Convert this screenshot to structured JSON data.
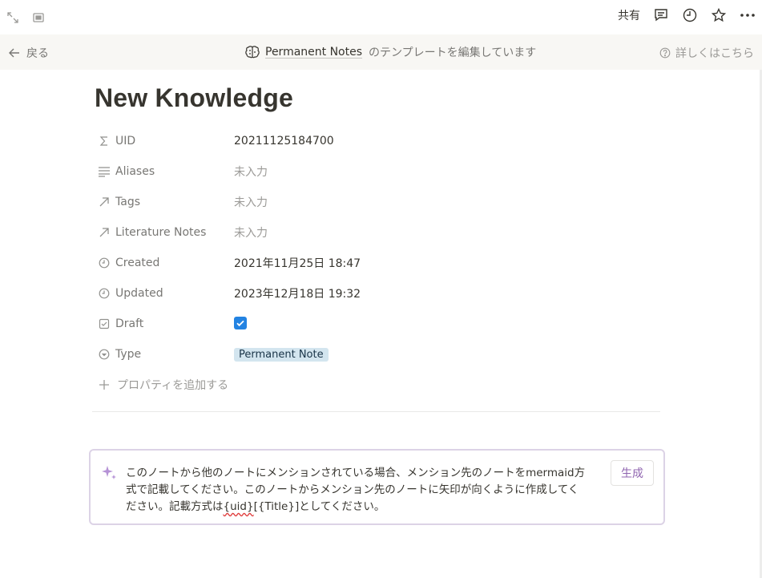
{
  "topbar": {
    "share_label": "共有"
  },
  "banner": {
    "back_label": "戻る",
    "database_name": "Permanent Notes",
    "message": "のテンプレートを編集しています",
    "help_label": "詳しくはこちら"
  },
  "page": {
    "title": "New Knowledge"
  },
  "properties": [
    {
      "name": "UID",
      "icon": "sigma-icon",
      "value": "20211125184700",
      "empty": false
    },
    {
      "name": "Aliases",
      "icon": "text-lines-icon",
      "value": "未入力",
      "empty": true
    },
    {
      "name": "Tags",
      "icon": "relation-arrow-icon",
      "value": "未入力",
      "empty": true
    },
    {
      "name": "Literature Notes",
      "icon": "relation-arrow-icon",
      "value": "未入力",
      "empty": true
    },
    {
      "name": "Created",
      "icon": "clock-icon",
      "value": "2021年11月25日 18:47",
      "empty": false
    },
    {
      "name": "Updated",
      "icon": "clock-icon",
      "value": "2023年12月18日 19:32",
      "empty": false
    },
    {
      "name": "Draft",
      "icon": "checkbox-icon",
      "checked": true
    },
    {
      "name": "Type",
      "icon": "select-icon",
      "tag": "Permanent Note"
    }
  ],
  "add_property_label": "プロパティを追加する",
  "ai_prompt": {
    "line1": "このノートから他のノートにメンションされている場合、メンション先のノートをmermaid方",
    "line2": "式で記載してください。このノートからメンション先のノートに矢印が向くように作成してく",
    "line3_before": "ださい。記載方式は",
    "line3_misspelled": "{uid}",
    "line3_after": "[{Title}]としてください。",
    "generate_label": "生成"
  },
  "colors": {
    "accent_blue": "#2383e2",
    "ai_purple": "#9065b0",
    "tag_bg": "#d3e5ef"
  }
}
